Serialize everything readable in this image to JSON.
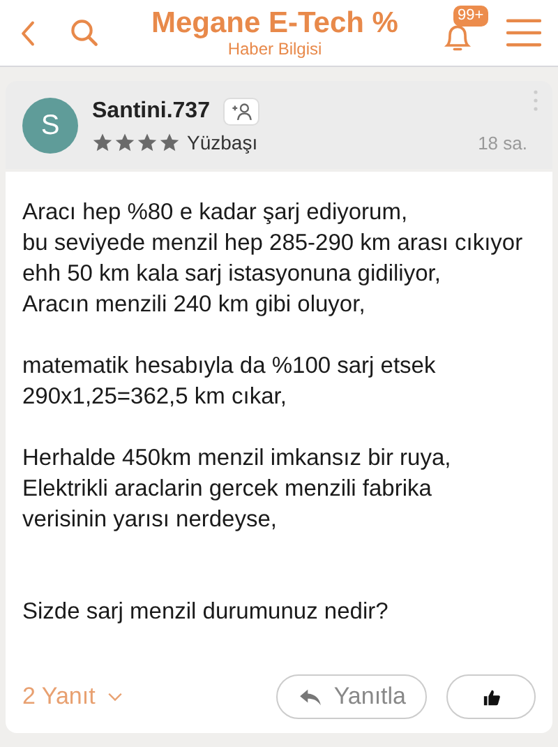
{
  "header": {
    "title": "Megane E-Tech %",
    "subtitle": "Haber Bilgisi",
    "notification_badge": "99+"
  },
  "post": {
    "avatar_letter": "S",
    "author": "Santini.737",
    "stars": 4,
    "rank": "Yüzbaşı",
    "time": "18 sa.",
    "body": "Aracı hep %80 e kadar şarj ediyorum,\nbu seviyede menzil hep 285-290 km arası cıkıyor\nehh 50 km kala sarj istasyonuna gidiliyor,\nAracın menzili 240 km gibi oluyor,\n\nmatematik hesabıyla da %100 sarj etsek\n290x1,25=362,5 km cıkar,\n\nHerhalde 450km menzil imkansız bir ruya,\nElektrikli araclarin gercek menzili fabrika\nverisinin yarısı nerdeyse,\n\n\nSizde sarj menzil durumunuz nedir?",
    "replies_label": "2 Yanıt",
    "reply_button": "Yanıtla"
  }
}
